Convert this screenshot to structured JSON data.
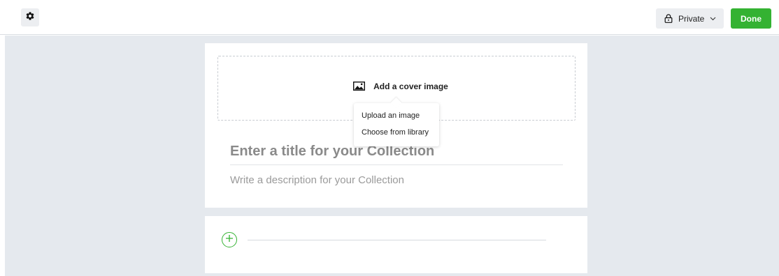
{
  "header": {
    "settings_icon": "gear-icon",
    "privacy": {
      "icon": "lock-icon",
      "label": "Private",
      "chevron": "chevron-down-icon"
    },
    "done_label": "Done"
  },
  "cover": {
    "icon": "image-icon",
    "label": "Add a cover image",
    "menu": [
      "Upload an image",
      "Choose from library"
    ]
  },
  "form": {
    "title_placeholder": "Enter a title for your Collection",
    "description_placeholder": "Write a description for your Collection"
  },
  "items": {
    "add_icon": "plus-circle-icon"
  },
  "colors": {
    "accent": "#34b232",
    "canvas": "#e5e9ee",
    "button_bg": "#eceef1"
  }
}
